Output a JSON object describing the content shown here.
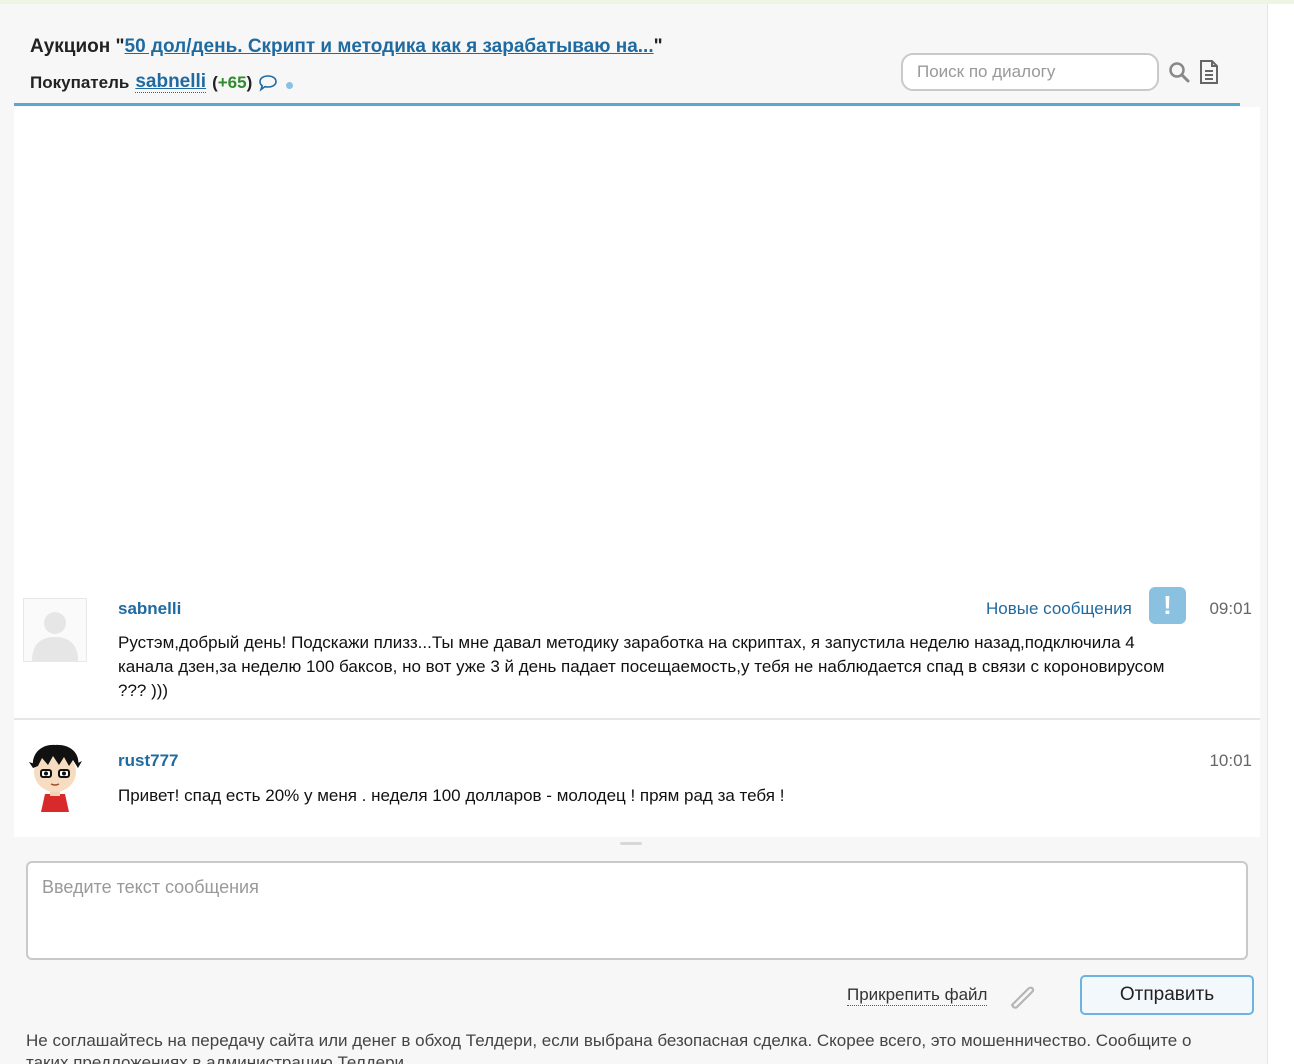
{
  "header": {
    "auction_prefix": "Аукцион \"",
    "auction_link": "50 дол/день. Скрипт и методика как я зарабатываю на...",
    "auction_suffix": "\"",
    "buyer_label": "Покупатель",
    "buyer_name": "sabnelli",
    "rating_open": "(",
    "rating_value": "+65",
    "rating_close": ")",
    "search_placeholder": "Поиск по диалогу"
  },
  "messages": [
    {
      "author": "sabnelli",
      "new_label": "Новые сообщения",
      "alert_symbol": "!",
      "time": "09:01",
      "text": "Рустэм,добрый день! Подскажи плизз...Ты мне давал методику заработка на скриптах, я запустила неделю назад,подключила 4 канала дзен,за неделю 100 баксов, но вот уже 3 й день падает посещаемость,у тебя не наблюдается спад в связи с короновирусом ??? )))"
    },
    {
      "author": "rust777",
      "time": "10:01",
      "text": "Привет! спад есть 20% у меня . неделя 100 долларов - молодец ! прям рад за тебя !"
    }
  ],
  "composer": {
    "placeholder": "Введите текст сообщения",
    "attach_label": "Прикрепить файл",
    "send_label": "Отправить"
  },
  "warning_text": "Не соглашайтесь на передачу сайта или денег в обход Телдери, если выбрана безопасная сделка. Скорее всего, это мошенничество. Сообщите о таких предложениях в администрацию Телдери.",
  "colors": {
    "link": "#1f6aa0",
    "accent": "#5aa7cf",
    "alert": "#8ac0e0",
    "rating": "#2e8b2e"
  }
}
